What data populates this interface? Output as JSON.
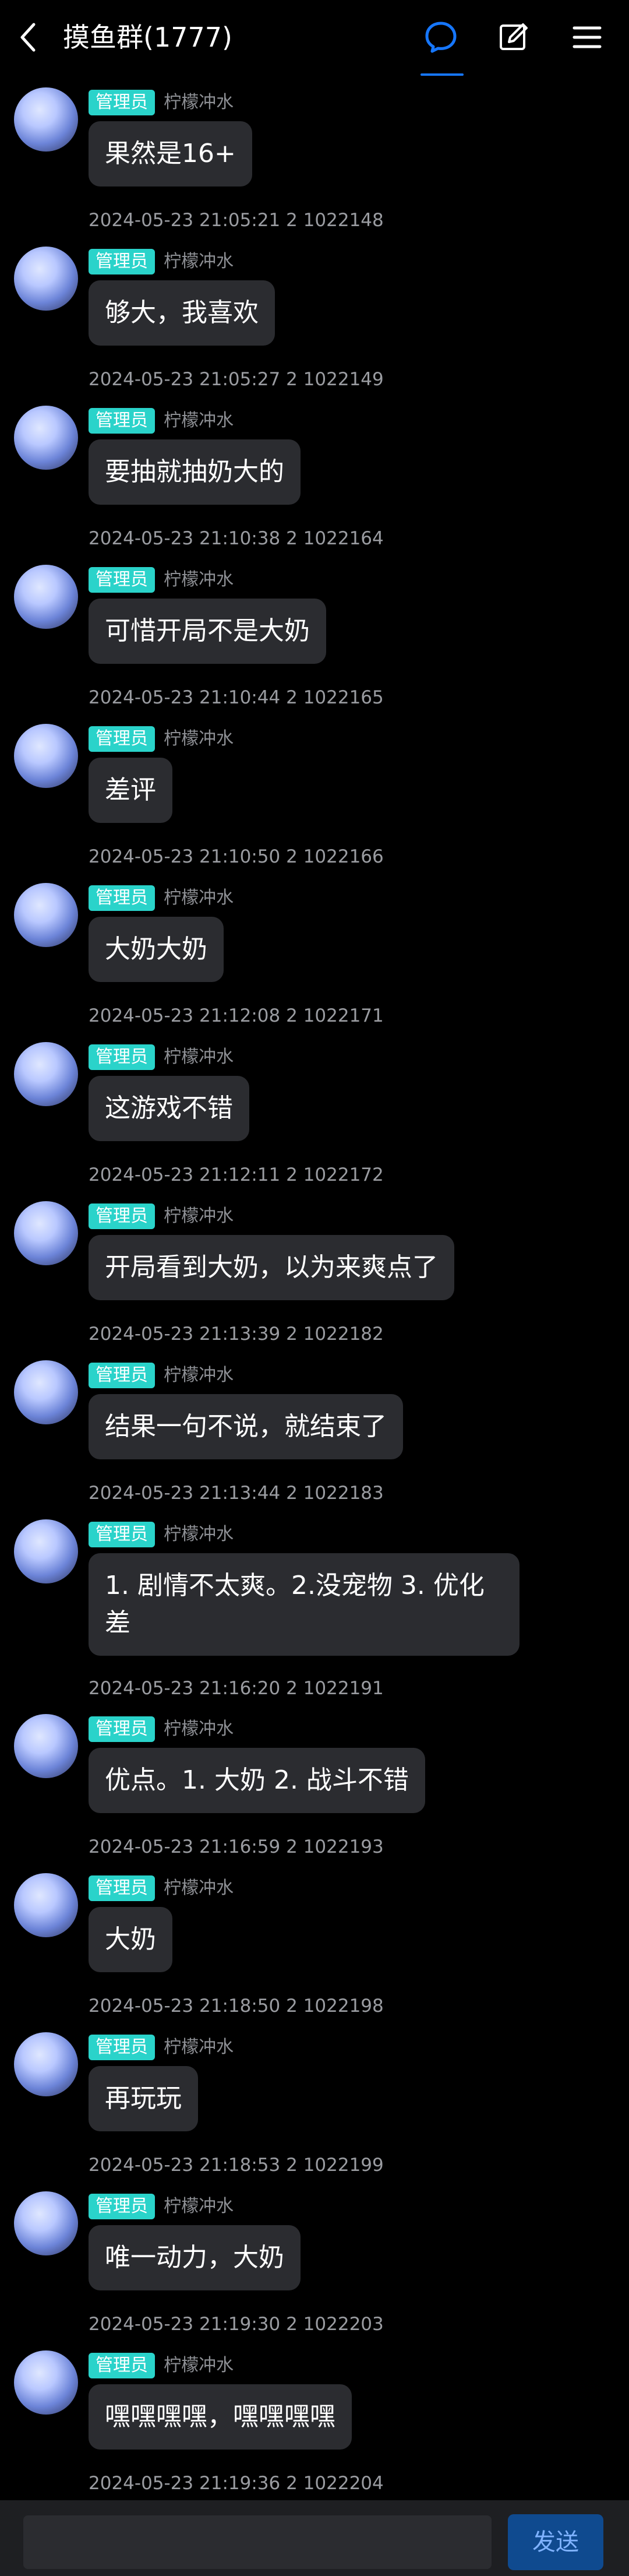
{
  "header": {
    "title": "摸鱼群(1777)",
    "icons": [
      "back-icon",
      "chat-bubble-icon",
      "edit-icon",
      "menu-icon"
    ],
    "accent": "#1677ff"
  },
  "messages": [
    {
      "badge": "管理员",
      "nickname": "柠檬冲水",
      "text": "果然是16+",
      "timestamp": "2024-05-23 21:05:21 2 1022148"
    },
    {
      "badge": "管理员",
      "nickname": "柠檬冲水",
      "text": "够大，我喜欢",
      "timestamp": "2024-05-23 21:05:27 2 1022149"
    },
    {
      "badge": "管理员",
      "nickname": "柠檬冲水",
      "text": "要抽就抽奶大的",
      "timestamp": "2024-05-23 21:10:38 2 1022164"
    },
    {
      "badge": "管理员",
      "nickname": "柠檬冲水",
      "text": "可惜开局不是大奶",
      "timestamp": "2024-05-23 21:10:44 2 1022165"
    },
    {
      "badge": "管理员",
      "nickname": "柠檬冲水",
      "text": "差评",
      "timestamp": "2024-05-23 21:10:50 2 1022166"
    },
    {
      "badge": "管理员",
      "nickname": "柠檬冲水",
      "text": "大奶大奶",
      "timestamp": "2024-05-23 21:12:08 2 1022171"
    },
    {
      "badge": "管理员",
      "nickname": "柠檬冲水",
      "text": "这游戏不错",
      "timestamp": "2024-05-23 21:12:11 2 1022172"
    },
    {
      "badge": "管理员",
      "nickname": "柠檬冲水",
      "text": "开局看到大奶，以为来爽点了",
      "timestamp": "2024-05-23 21:13:39 2 1022182"
    },
    {
      "badge": "管理员",
      "nickname": "柠檬冲水",
      "text": "结果一句不说，就结束了",
      "timestamp": "2024-05-23 21:13:44 2 1022183"
    },
    {
      "badge": "管理员",
      "nickname": "柠檬冲水",
      "text": "1. 剧情不太爽。2.没宠物 3. 优化\n差",
      "timestamp": "2024-05-23 21:16:20 2 1022191"
    },
    {
      "badge": "管理员",
      "nickname": "柠檬冲水",
      "text": "优点。1. 大奶 2. 战斗不错",
      "timestamp": "2024-05-23 21:16:59 2 1022193"
    },
    {
      "badge": "管理员",
      "nickname": "柠檬冲水",
      "text": "大奶",
      "timestamp": "2024-05-23 21:18:50 2 1022198"
    },
    {
      "badge": "管理员",
      "nickname": "柠檬冲水",
      "text": "再玩玩",
      "timestamp": "2024-05-23 21:18:53 2 1022199"
    },
    {
      "badge": "管理员",
      "nickname": "柠檬冲水",
      "text": "唯一动力，大奶",
      "timestamp": "2024-05-23 21:19:30 2 1022203"
    },
    {
      "badge": "管理员",
      "nickname": "柠檬冲水",
      "text": "嘿嘿嘿嘿，嘿嘿嘿嘿",
      "timestamp": "2024-05-23 21:19:36 2 1022204"
    }
  ],
  "composer": {
    "placeholder": "",
    "send_label": "发送"
  }
}
